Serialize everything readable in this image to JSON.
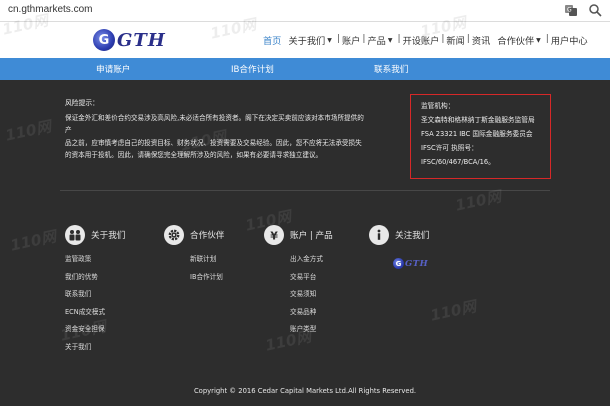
{
  "browser": {
    "url": "cn.gthmarkets.com"
  },
  "header": {
    "logo_letter": "G",
    "logo_text": "GTH",
    "nav": [
      {
        "label": "首页",
        "active": true,
        "caret": false
      },
      {
        "label": "关于我们",
        "active": false,
        "caret": true
      },
      {
        "label": "账户",
        "active": false,
        "caret": false
      },
      {
        "label": "产品",
        "active": false,
        "caret": true
      },
      {
        "label": "开设账户",
        "active": false,
        "caret": false
      },
      {
        "label": "新闻",
        "active": false,
        "caret": false
      },
      {
        "label": "资讯",
        "active": false,
        "caret": false
      },
      {
        "label": "合作伙伴",
        "active": false,
        "caret": true
      },
      {
        "label": "用户中心",
        "active": false,
        "caret": false
      }
    ],
    "nav_sep": "|"
  },
  "subnav": {
    "items": [
      "申请账户",
      "IB合作计划",
      "联系我们"
    ]
  },
  "risk": {
    "title": "风险提示：",
    "lines": [
      "保证金外汇和差价合约交易涉及高风险,未必适合所有投资者。阁下在决定买卖前应该对本市场所提供的产",
      "品之前，应审慎考虑自己的投资目标、财务状况、投资需要及交易经验。因此，您不应将无法承受损失",
      "的资本用于投机。因此，请确保您完全理解所涉及的风险，如果有必要请寻求独立建议。"
    ]
  },
  "regulator": {
    "title": "监管机构：",
    "lines": [
      "圣文森特和格林纳丁斯金融服务监管局",
      "FSA 23321 IBC 国际金融服务委员会",
      "IFSC许可 执照号：",
      "IFSC/60/467/BCA/16。"
    ]
  },
  "footer": {
    "columns": [
      {
        "title": "关于我们",
        "icon": "people-icon",
        "links": [
          "监管政策",
          "我们的优势",
          "联系我们",
          "ECN成交模式",
          "资金安全担保",
          "关于我们"
        ]
      },
      {
        "title": "合作伙伴",
        "icon": "gear-icon",
        "links": [
          "新联计划",
          "IB合作计划"
        ]
      },
      {
        "title": "账户 | 产品",
        "icon": "yen-icon",
        "links": [
          "出入金方式",
          "交易平台",
          "交易须知",
          "交易品种",
          "账户类型"
        ]
      },
      {
        "title": "关注我们",
        "icon": "info-icon",
        "links": []
      }
    ],
    "logo_letter": "G",
    "logo_text": "GTH",
    "copyright": "Copyright © 2016 Cedar Capital Markets Ltd.All Rights Reserved."
  },
  "watermark": "110网",
  "colors": {
    "accent": "#3f8bd6",
    "active_nav": "#3c84c9",
    "background": "#2d2d2d",
    "regulator_border": "#d62828"
  }
}
